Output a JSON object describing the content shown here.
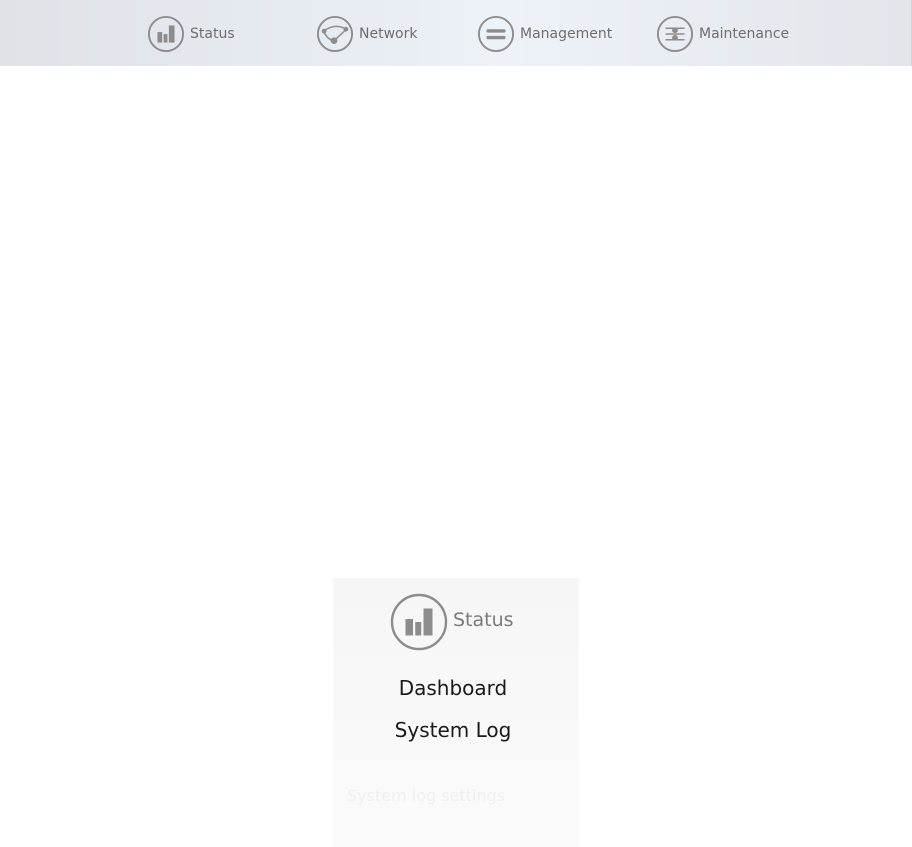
{
  "nav": {
    "items": [
      {
        "label": "Status",
        "icon": "bar-chart-icon"
      },
      {
        "label": "Network",
        "icon": "network-icon"
      },
      {
        "label": "Management",
        "icon": "management-icon"
      },
      {
        "label": "Maintenance",
        "icon": "sliders-icon"
      }
    ]
  },
  "dropdown": {
    "header": "Status",
    "items": [
      {
        "label": "Dashboard"
      },
      {
        "label": "System Log"
      }
    ],
    "ghost_text": "System log settings"
  },
  "colors": {
    "icon_gray": "#8c8c8c",
    "nav_text": "#6e6e6e",
    "menu_text": "#1a1a1a"
  }
}
